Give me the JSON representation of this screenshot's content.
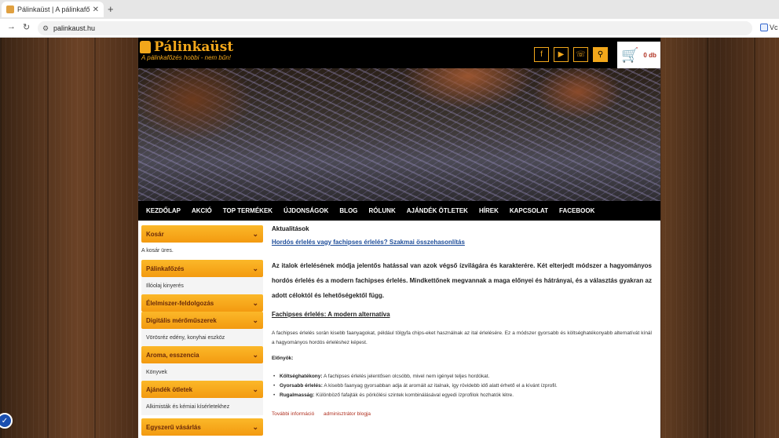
{
  "browser": {
    "tab_title": "Pálinkaüst | A pálinkafőzés h",
    "tab_close": "✕",
    "new_tab": "+",
    "url": "palinkaust.hu",
    "extension_label": "Vc"
  },
  "header": {
    "brand": "Pálinkaüst",
    "tagline": "A pálinkafőzés hobbi - nem bűn!",
    "cart_count": "0 db",
    "icons": [
      "facebook-icon",
      "youtube-icon",
      "phone-icon",
      "search-icon"
    ]
  },
  "menu": {
    "items": [
      "KEZDŐLAP",
      "AKCIÓ",
      "TOP TERMÉKEK",
      "ÚJDONSÁGOK",
      "BLOG",
      "RÓLUNK",
      "AJÁNDÉK ÖTLETEK",
      "HÍREK",
      "KAPCSOLAT",
      "FACEBOOK"
    ]
  },
  "sidebar": {
    "cart_title": "Kosár",
    "cart_empty": "A kosár üres.",
    "cat1": "Pálinkafőzés",
    "sub1": "Illóolaj kinyerés",
    "cat2": "Élelmiszer-feldolgozás",
    "cat3": "Digitális mérőműszerek",
    "sub3": "Vörösréz edény, konyhai eszköz",
    "cat4": "Aroma, esszencia",
    "sub4": "Könyvek",
    "cat5": "Ajándék ötletek",
    "sub5": "Alkimisták és kémiai kísérletekhez",
    "cat6": "Egyszerű vásárlás"
  },
  "main": {
    "section_title": "Aktualitások",
    "post_title": "Hordós érlelés vagy fachipses érlelés? Szakmai összehasonlítás",
    "intro": "Az italok érlelésének módja jelentős hatással van azok végső ízvilágára és karakterére. Két elterjedt módszer a hagyományos hordós érlelés és a modern fachipses érlelés. Mindkettőnek megvannak a maga előnyei és hátrányai, és a választás gyakran az adott céloktól és lehetőségektől függ.",
    "subsection": "Fachipses érlelés: A modern alternatíva",
    "paragraph": "A fachipses érlelés során kisebb faanyagokat, például tölgyfa chips-eket használnak az ital érlelésére. Ez a módszer gyorsabb és költséghatékonyabb alternatívát kínál a hagyományos hordós érleléshez képest.",
    "pros_title": "Előnyök:",
    "pros": [
      {
        "label": "Költséghatékony:",
        "text": " A fachipses érlelés jelentősen olcsóbb, mivel nem igényel teljes hordókat."
      },
      {
        "label": "Gyorsabb érlelés:",
        "text": " A kisebb faanyag gyorsabban adja át aromáit az italnak, így rövidebb idő alatt érhető el a kívánt ízprofil."
      },
      {
        "label": "Rugalmasság:",
        "text": " Különböző fafajták és pörkölési szintek kombinálásával egyedi ízprofilok hozhatók létre."
      }
    ],
    "more_link": "További információ",
    "author_link": "adminisztrátor blogja"
  }
}
